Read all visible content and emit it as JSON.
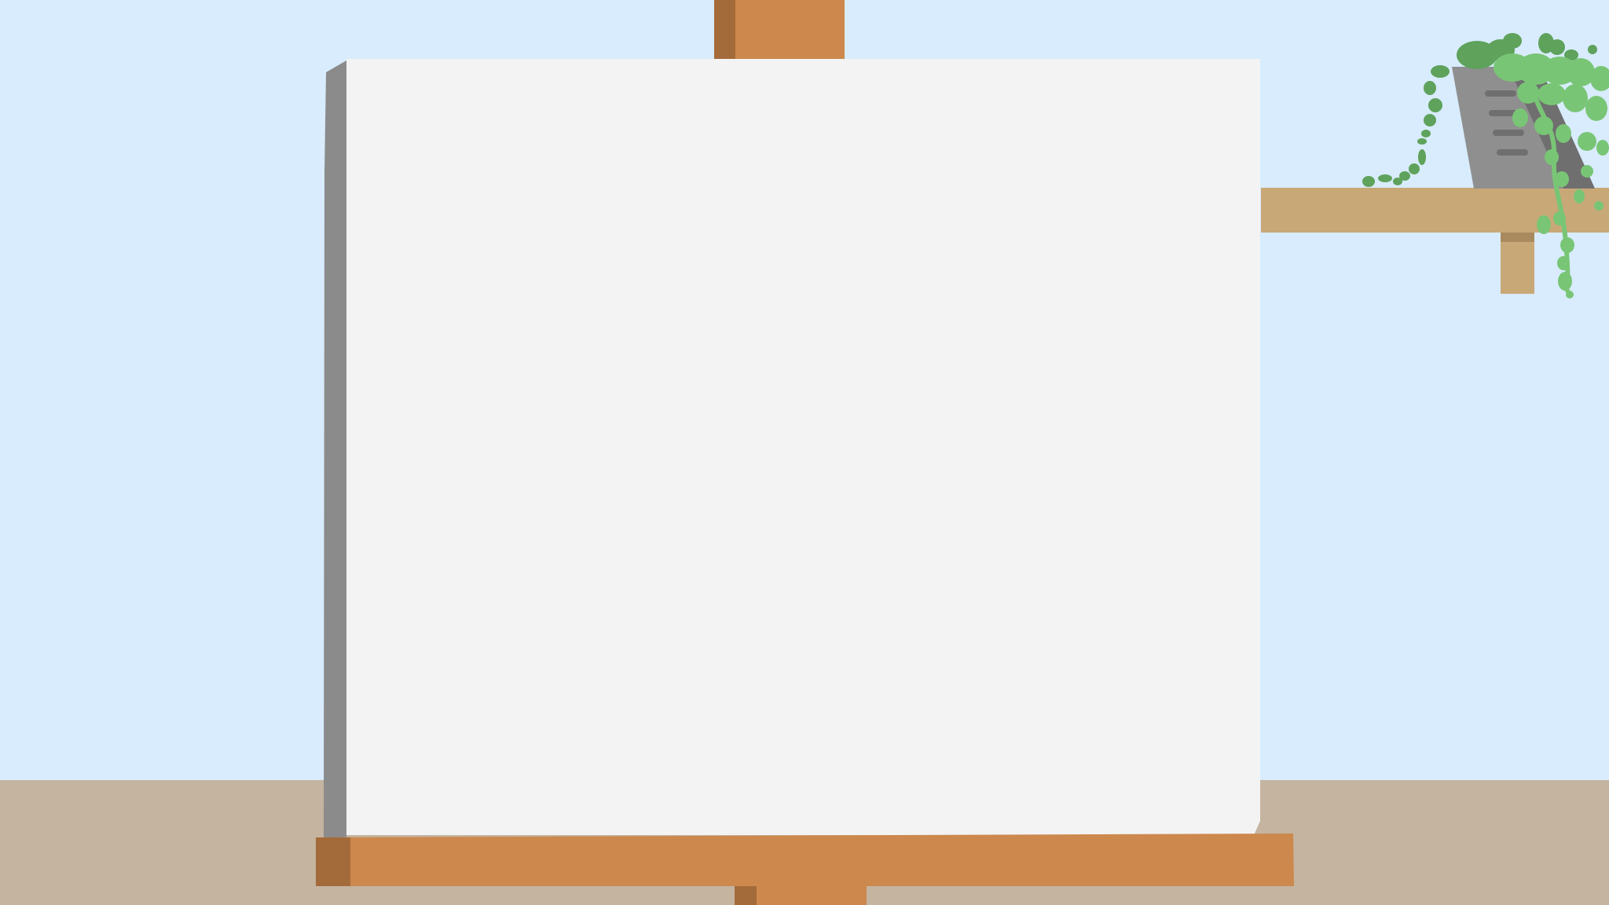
{
  "scene": {
    "colors": {
      "wall": "#d8ecfd",
      "floor": "#c4b4a0",
      "easel_wood": "#cd884d",
      "easel_wood_dark": "#a46b3a",
      "canvas_face": "#f3f3f3",
      "canvas_edge": "#8b8b8b",
      "shelf": "#c9a877",
      "shelf_dark": "#a98a5e",
      "pot": "#8f8f8f",
      "pot_dark": "#6f6f6f",
      "leaf_light": "#79c576",
      "leaf_dark": "#5ea25c"
    },
    "icons": [
      "easel-icon",
      "blank-canvas-icon",
      "wall-shelf-icon",
      "hanging-plant-icon"
    ]
  }
}
